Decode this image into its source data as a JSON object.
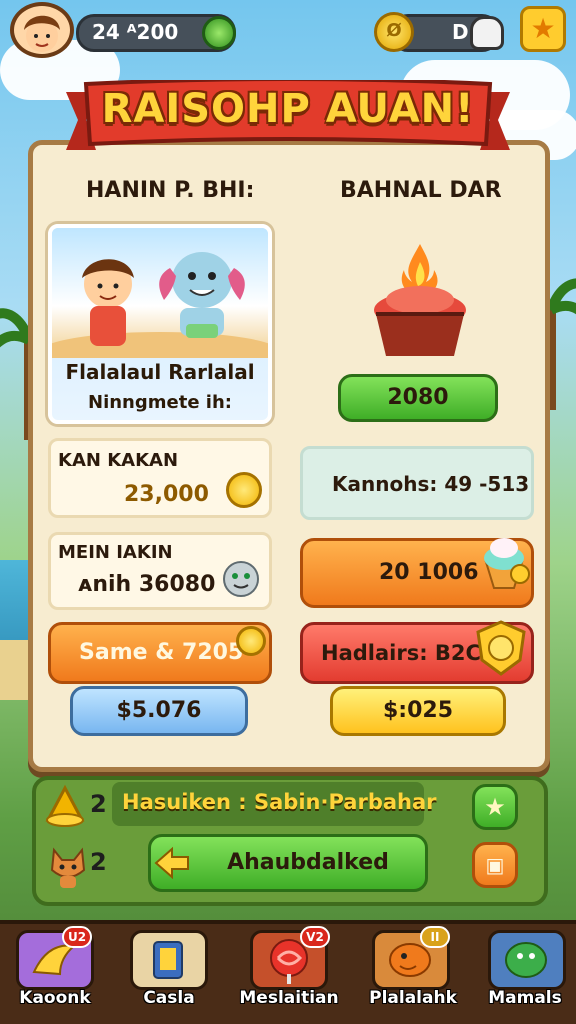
{
  "top_bar": {
    "currency_1": "24 ᴬ200",
    "currency_2": "D"
  },
  "banner": {
    "title": "RAISOHP AUAN!"
  },
  "columns": {
    "left_title": "HANIN P. BHI:",
    "right_title": "BAHNAL DAR"
  },
  "hero": {
    "name": "Flalalaul Rarlalal",
    "subtitle": "Ninngmete ih:"
  },
  "left_cards": [
    {
      "label": "KAN KAKAN",
      "value": "23,000"
    },
    {
      "label": "MEIN IAKIN",
      "value": "ᴀnih 36080"
    }
  ],
  "right": {
    "price_button": "2080",
    "info_card": "Kannohs: 49 -513",
    "orange_bar": "20 1006"
  },
  "left_bar": "Same  & 7205",
  "red_bar": "Hadlairs: B2C5",
  "blue_button": "$5.076",
  "yellow_button": "$:025",
  "quest": {
    "text": "Hasuiken : Sabin·Parbahar",
    "count_1": "2",
    "count_2": "2",
    "action_button": "Ahaubdalked"
  },
  "nav": {
    "items": [
      {
        "label": "Kaoonk",
        "badge": "U2",
        "color": "#a46ddb"
      },
      {
        "label": "Casla",
        "badge": "",
        "color": "#e9d4a5"
      },
      {
        "label": "Meslaitian",
        "badge": "V2",
        "color": "#c5502b"
      },
      {
        "label": "Plalalahk",
        "badge": "II",
        "color": "#d98a3b"
      },
      {
        "label": "Mamals",
        "badge": "",
        "color": "#4f7fbf"
      }
    ]
  },
  "icons": [
    "avatar",
    "gem-icon",
    "coin-icon",
    "skull-icon",
    "star-icon",
    "cupcake-fire-icon",
    "smiley-coin-icon",
    "ghost-icon",
    "ice-cream-icon",
    "shield-coin-icon",
    "gold-pile-icon",
    "cat-icon",
    "arrow-left-icon",
    "star-button-icon",
    "scroll-button-icon"
  ]
}
